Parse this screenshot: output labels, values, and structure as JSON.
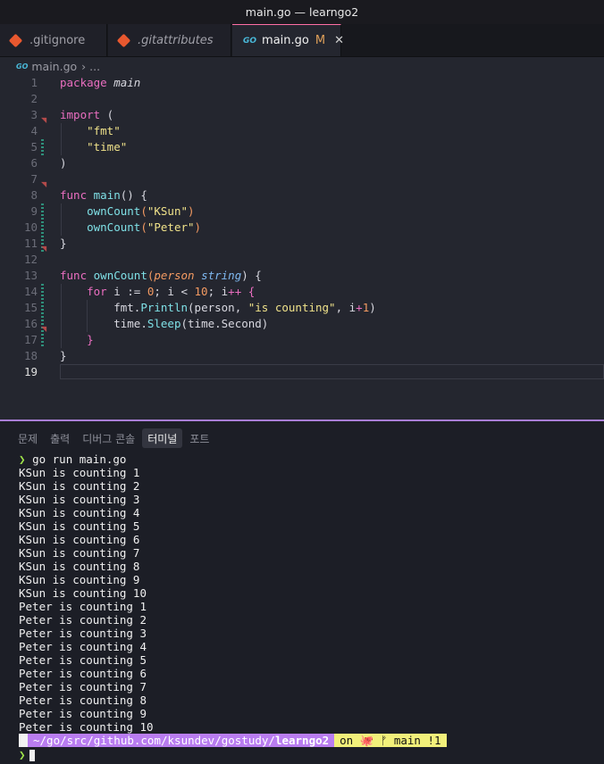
{
  "window": {
    "title": "main.go — learngo2"
  },
  "tabs": [
    {
      "label": ".gitignore"
    },
    {
      "label": ".gitattributes"
    },
    {
      "icon_text": "GO",
      "label": "main.go",
      "status": "M"
    }
  ],
  "breadcrumb": {
    "icon_text": "GO",
    "file": "main.go",
    "sep": "› ..."
  },
  "editor": {
    "lines": [
      {
        "n": "1"
      },
      {
        "n": "2"
      },
      {
        "n": "3"
      },
      {
        "n": "4"
      },
      {
        "n": "5"
      },
      {
        "n": "6"
      },
      {
        "n": "7"
      },
      {
        "n": "8"
      },
      {
        "n": "9"
      },
      {
        "n": "10"
      },
      {
        "n": "11"
      },
      {
        "n": "12"
      },
      {
        "n": "13"
      },
      {
        "n": "14"
      },
      {
        "n": "15"
      },
      {
        "n": "16"
      },
      {
        "n": "17"
      },
      {
        "n": "18"
      },
      {
        "n": "19"
      }
    ],
    "code": {
      "l1_kw": "package",
      "l1_name": "main",
      "l3_kw": "import",
      "l3_paren": " (",
      "l4_str": "\"fmt\"",
      "l5_str": "\"time\"",
      "l6": ")",
      "l8_kw": "func",
      "l8_fn": "main",
      "l8_rest": "() {",
      "l9_fn": "ownCount",
      "l9_open": "(",
      "l9_str": "\"KSun\"",
      "l9_close": ")",
      "l10_fn": "ownCount",
      "l10_open": "(",
      "l10_str": "\"Peter\"",
      "l10_close": ")",
      "l11": "}",
      "l13_kw": "func",
      "l13_fn": "ownCount",
      "l13_open": "(",
      "l13_param": "person",
      "l13_type": "string",
      "l13_close": ") {",
      "l14_kw": "for",
      "l14_a": " i := ",
      "l14_n0": "0",
      "l14_b": "; i < ",
      "l14_n10": "10",
      "l14_c": "; i",
      "l14_op": "++",
      "l14_brace": " {",
      "l15_pkg": "fmt.",
      "l15_fn": "Println",
      "l15_a": "(person, ",
      "l15_str": "\"is counting\"",
      "l15_b": ", i",
      "l15_op": "+",
      "l15_n": "1",
      "l15_c": ")",
      "l16_pkg": "time.",
      "l16_fn": "Sleep",
      "l16_a": "(time.Second)",
      "l17": "}",
      "l18": "}"
    }
  },
  "panel": {
    "tabs": [
      "문제",
      "출력",
      "디버그 콘솔",
      "터미널",
      "포트"
    ],
    "active_tab": "터미널",
    "terminal": {
      "prompt_symbol": "❯",
      "command": "go run main.go",
      "output": [
        "KSun is counting 1",
        "KSun is counting 2",
        "KSun is counting 3",
        "KSun is counting 4",
        "KSun is counting 5",
        "KSun is counting 6",
        "KSun is counting 7",
        "KSun is counting 8",
        "KSun is counting 9",
        "KSun is counting 10",
        "Peter is counting 1",
        "Peter is counting 2",
        "Peter is counting 3",
        "Peter is counting 4",
        "Peter is counting 5",
        "Peter is counting 6",
        "Peter is counting 7",
        "Peter is counting 8",
        "Peter is counting 9",
        "Peter is counting 10"
      ],
      "powerline": {
        "apple": "",
        "path_prefix": "~/go/src/github.com/ksundev/gostudy/",
        "path_dir": "learngo2",
        "git": "on 🐙 ᚠ main !1"
      }
    }
  },
  "colors": {
    "accent": "#ff6fa5",
    "panel_border": "#a97ed6",
    "prompt": "#9fe34a"
  }
}
